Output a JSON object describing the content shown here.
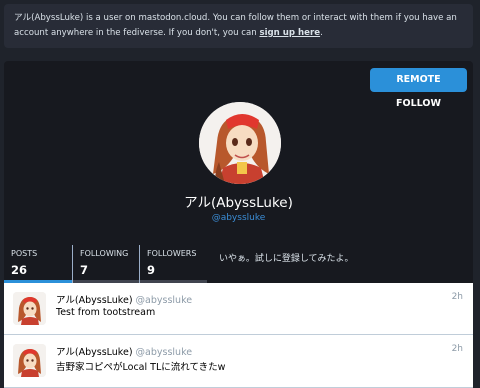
{
  "notice": {
    "text": "アル(AbyssLuke) is a user on mastodon.cloud. You can follow them or interact with them if you have an account anywhere in the fediverse. If you don't, you can ",
    "signup_link": "sign up here",
    "suffix": "."
  },
  "header": {
    "remote_label": "REMOTE",
    "follow_label": "FOLLOW",
    "display_name": "アル(AbyssLuke)",
    "handle": "@abyssluke",
    "bio": "いやぁ。試しに登録してみたよ。"
  },
  "counters": [
    {
      "label": "POSTS",
      "value": "26"
    },
    {
      "label": "FOLLOWING",
      "value": "7"
    },
    {
      "label": "FOLLOWERS",
      "value": "9"
    }
  ],
  "statuses": [
    {
      "display_name": "アル(AbyssLuke)",
      "acct": "@abyssluke",
      "time": "2h",
      "content": "Test from tootstream"
    },
    {
      "display_name": "アル(AbyssLuke)",
      "acct": "@abyssluke",
      "time": "2h",
      "content": "吉野家コピペがLocal TLに流れてきたw"
    }
  ],
  "colors": {
    "accent": "#2b90d9",
    "background": "#1f232b",
    "card": "#17191f"
  }
}
